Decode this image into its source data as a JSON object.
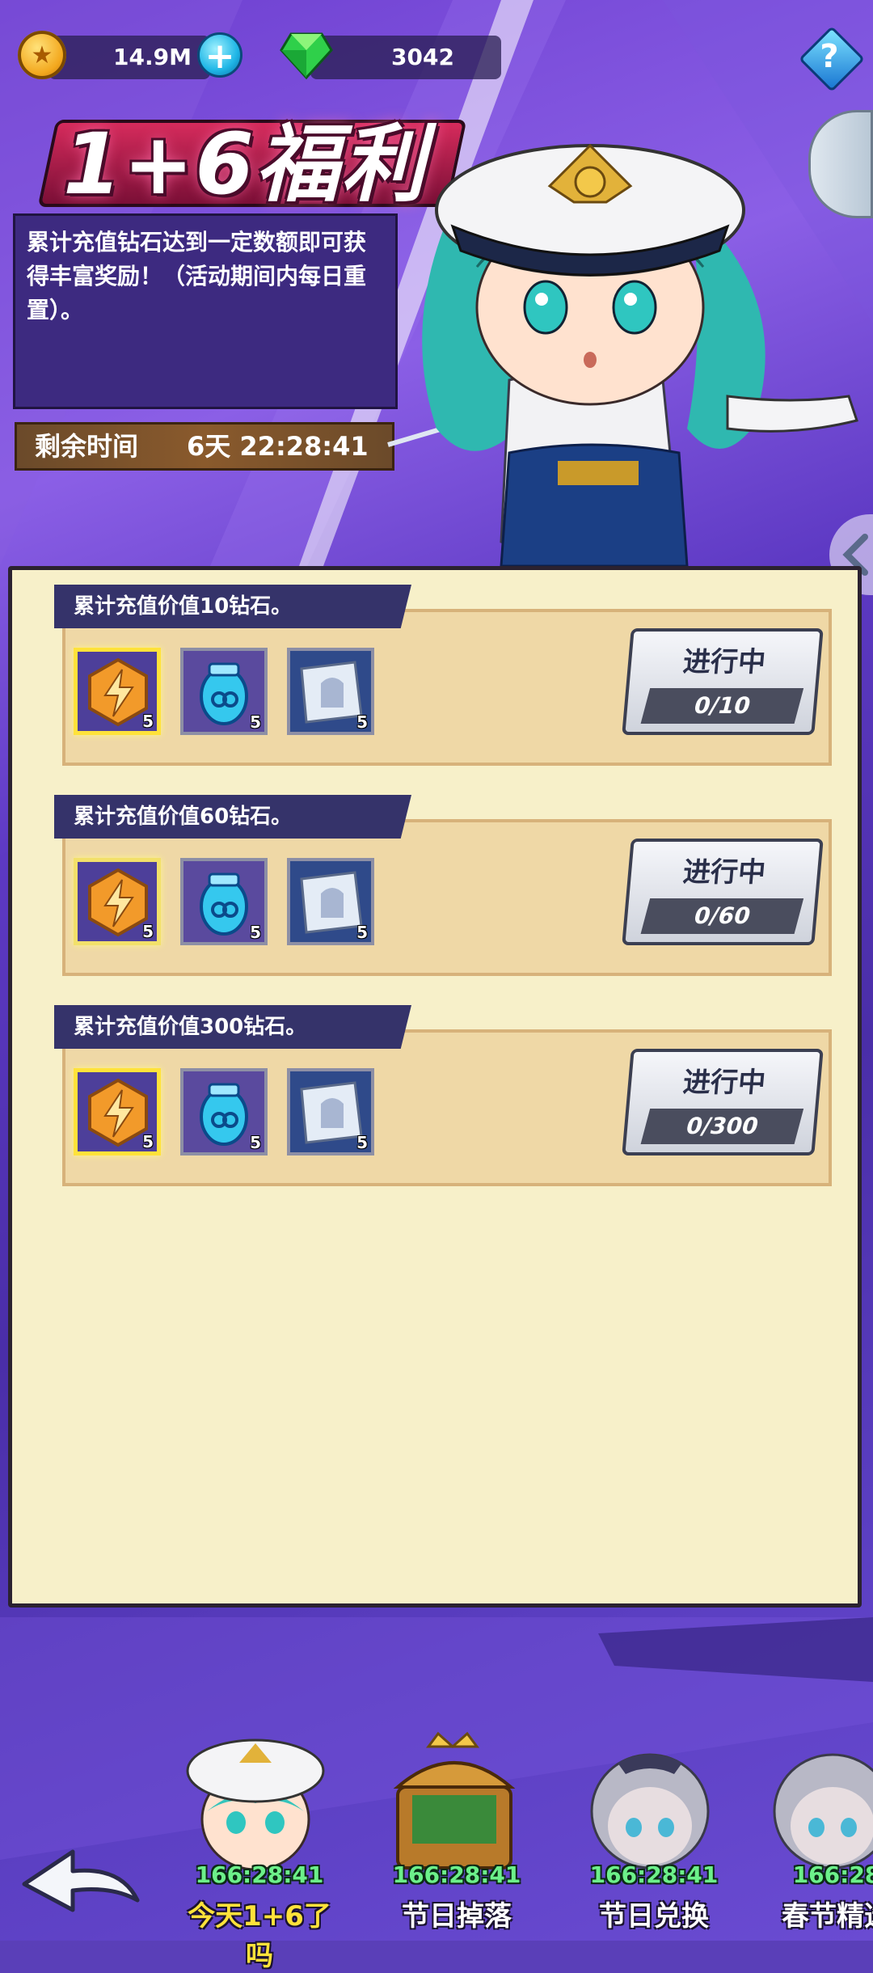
{
  "currency": {
    "coins": "14.9M",
    "gems": "3042"
  },
  "event": {
    "title": "1+6福利",
    "description": "累计充值钻石达到一定数额即可获得丰富奖励！（活动期间内每日重置）。",
    "time_label": "剩余时间",
    "time_value": "6天 22:28:41"
  },
  "tasks": [
    {
      "title": "累计充值价值10钻石。",
      "items": [
        {
          "icon": "energy-token-icon",
          "count": "5"
        },
        {
          "icon": "blue-egg-icon",
          "count": "5"
        },
        {
          "icon": "blueprint-scroll-icon",
          "count": "5"
        }
      ],
      "status": "进行中",
      "progress": "0/10"
    },
    {
      "title": "累计充值价值60钻石。",
      "items": [
        {
          "icon": "energy-token-icon",
          "count": "5"
        },
        {
          "icon": "blue-egg-icon",
          "count": "5"
        },
        {
          "icon": "blueprint-scroll-icon",
          "count": "5"
        }
      ],
      "status": "进行中",
      "progress": "0/60"
    },
    {
      "title": "累计充值价值300钻石。",
      "items": [
        {
          "icon": "energy-token-icon",
          "count": "5"
        },
        {
          "icon": "blue-egg-icon",
          "count": "5"
        },
        {
          "icon": "blueprint-scroll-icon",
          "count": "5"
        }
      ],
      "status": "进行中",
      "progress": "0/300"
    }
  ],
  "bottom_tabs": [
    {
      "label": "今天1+6了吗",
      "timer": "166:28:41",
      "active": true
    },
    {
      "label": "节日掉落",
      "timer": "166:28:41",
      "active": false
    },
    {
      "label": "节日兑换",
      "timer": "166:28:41",
      "active": false
    },
    {
      "label": "春节精选",
      "timer": "166:28",
      "active": false
    }
  ],
  "colors": {
    "accent_gold": "#ffe23a",
    "panel_bg": "#f7f0c9",
    "header_bg": "#35336a",
    "timer_green": "#6cf08a"
  }
}
